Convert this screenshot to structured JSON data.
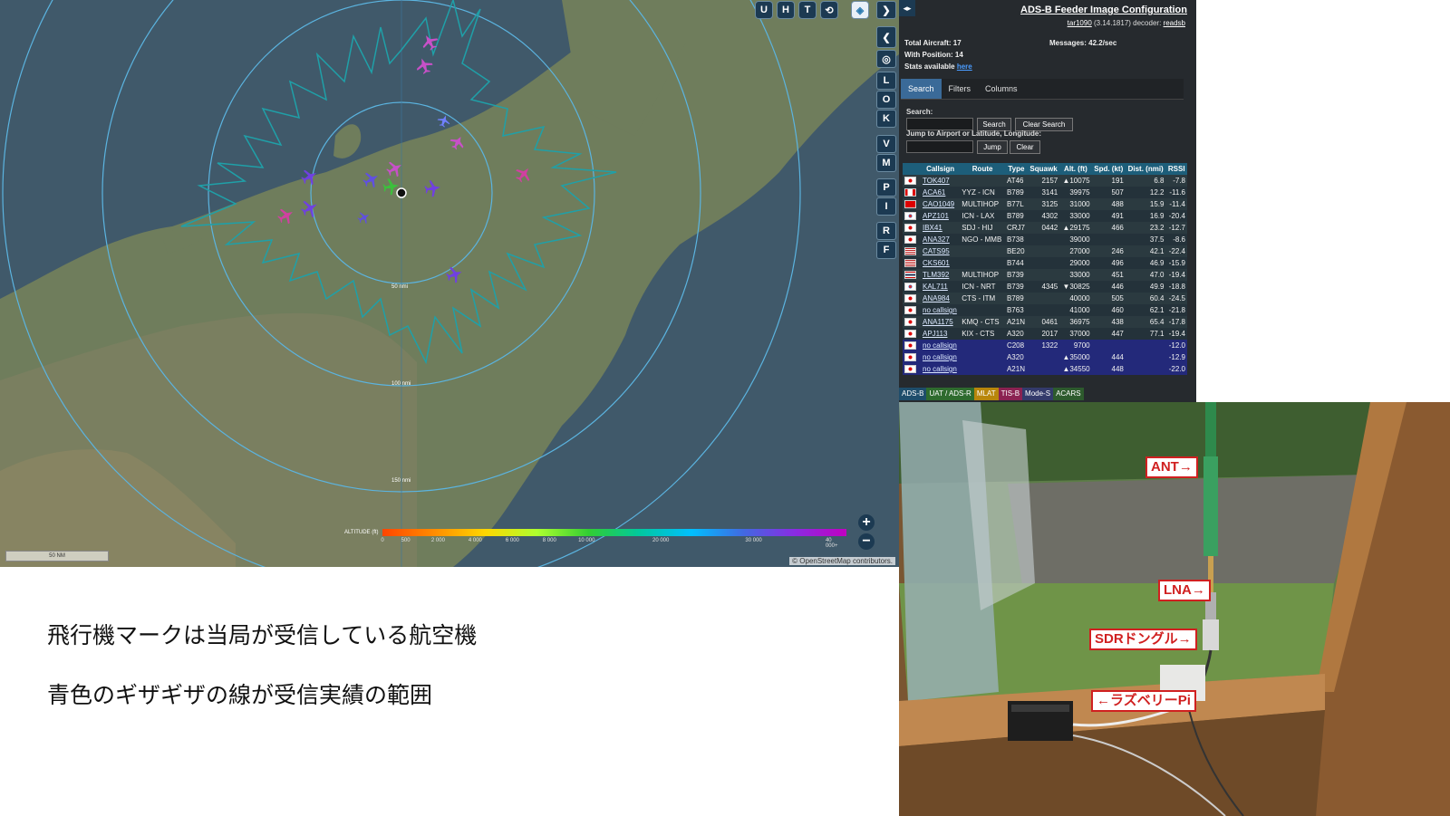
{
  "map": {
    "top_buttons": [
      "U",
      "H",
      "T"
    ],
    "side_buttons": [
      "L",
      "O",
      "K",
      "V",
      "M",
      "P",
      "I",
      "R",
      "F"
    ],
    "altitude_title": "ALTITUDE (ft)",
    "altitude_ticks": [
      "0",
      "500",
      "2 000",
      "4 000",
      "6 000",
      "8 000",
      "10 000",
      "20 000",
      "30 000",
      "40 000+"
    ],
    "ring_labels": [
      "50 nmi",
      "100 nmi",
      "150 nmi"
    ],
    "scale": "50 NM",
    "attribution": "© OpenStreetMap contributors."
  },
  "panel": {
    "title": "ADS-B Feeder Image Configuration",
    "version_link": "tar1090",
    "version_text": "(3.14.1817) decoder:",
    "decoder_link": "readsb",
    "total_aircraft": "Total Aircraft: 17",
    "with_position": "With Position: 14",
    "messages": "Messages: 42.2/sec",
    "stats_text": "Stats available",
    "stats_link": "here",
    "tabs": [
      "Search",
      "Filters",
      "Columns"
    ],
    "search_label": "Search:",
    "search_button": "Search",
    "clear_search_button": "Clear Search",
    "jump_label": "Jump to Airport or Latitude, Longitude:",
    "jump_button": "Jump",
    "clear_button": "Clear",
    "columns": [
      "Callsign",
      "Route",
      "Type",
      "Squawk",
      "Alt. (ft)",
      "Spd. (kt)",
      "Dist. (nmi)",
      "RSSI"
    ],
    "rows": [
      {
        "flag": "jp",
        "callsign": "TOK407",
        "route": "",
        "type": "AT46",
        "squawk": "2157",
        "alt": "▲10075",
        "spd": "191",
        "dist": "6.8",
        "rssi": "-7.8",
        "pos": true
      },
      {
        "flag": "ca",
        "callsign": "ACA61",
        "route": "YYZ - ICN",
        "type": "B789",
        "squawk": "3141",
        "alt": "39975",
        "spd": "507",
        "dist": "12.2",
        "rssi": "-11.6",
        "pos": true
      },
      {
        "flag": "cn",
        "callsign": "CAO1049",
        "route": "MULTIHOP",
        "type": "B77L",
        "squawk": "3125",
        "alt": "31000",
        "spd": "488",
        "dist": "15.9",
        "rssi": "-11.4",
        "pos": true
      },
      {
        "flag": "kr",
        "callsign": "APZ101",
        "route": "ICN - LAX",
        "type": "B789",
        "squawk": "4302",
        "alt": "33000",
        "spd": "491",
        "dist": "16.9",
        "rssi": "-20.4",
        "pos": true
      },
      {
        "flag": "jp",
        "callsign": "IBX41",
        "route": "SDJ - HIJ",
        "type": "CRJ7",
        "squawk": "0442",
        "alt": "▲29175",
        "spd": "466",
        "dist": "23.2",
        "rssi": "-12.7",
        "pos": true
      },
      {
        "flag": "jp",
        "callsign": "ANA327",
        "route": "NGO - MMB",
        "type": "B738",
        "squawk": "",
        "alt": "39000",
        "spd": "",
        "dist": "37.5",
        "rssi": "-8.6",
        "pos": true
      },
      {
        "flag": "us",
        "callsign": "CATS95",
        "route": "",
        "type": "BE20",
        "squawk": "",
        "alt": "27000",
        "spd": "246",
        "dist": "42.1",
        "rssi": "-22.4",
        "pos": true
      },
      {
        "flag": "us",
        "callsign": "CKS601",
        "route": "",
        "type": "B744",
        "squawk": "",
        "alt": "29000",
        "spd": "496",
        "dist": "46.9",
        "rssi": "-15.9",
        "pos": true
      },
      {
        "flag": "th",
        "callsign": "TLM392",
        "route": "MULTIHOP",
        "type": "B739",
        "squawk": "",
        "alt": "33000",
        "spd": "451",
        "dist": "47.0",
        "rssi": "-19.4",
        "pos": true
      },
      {
        "flag": "kr",
        "callsign": "KAL711",
        "route": "ICN - NRT",
        "type": "B739",
        "squawk": "4345",
        "alt": "▼30825",
        "spd": "446",
        "dist": "49.9",
        "rssi": "-18.8",
        "pos": true
      },
      {
        "flag": "jp",
        "callsign": "ANA984",
        "route": "CTS - ITM",
        "type": "B789",
        "squawk": "",
        "alt": "40000",
        "spd": "505",
        "dist": "60.4",
        "rssi": "-24.5",
        "pos": true
      },
      {
        "flag": "jp",
        "callsign": "no callsign",
        "route": "",
        "type": "B763",
        "squawk": "",
        "alt": "41000",
        "spd": "460",
        "dist": "62.1",
        "rssi": "-21.8",
        "pos": true
      },
      {
        "flag": "jp",
        "callsign": "ANA1175",
        "route": "KMQ - CTS",
        "type": "A21N",
        "squawk": "0461",
        "alt": "36975",
        "spd": "438",
        "dist": "65.4",
        "rssi": "-17.8",
        "pos": true
      },
      {
        "flag": "jp",
        "callsign": "APJ113",
        "route": "KIX - CTS",
        "type": "A320",
        "squawk": "2017",
        "alt": "37000",
        "spd": "447",
        "dist": "77.1",
        "rssi": "-19.4",
        "pos": true
      },
      {
        "flag": "jp",
        "callsign": "no callsign",
        "route": "",
        "type": "C208",
        "squawk": "1322",
        "alt": "9700",
        "spd": "",
        "dist": "",
        "rssi": "-12.0",
        "pos": false
      },
      {
        "flag": "jp",
        "callsign": "no callsign",
        "route": "",
        "type": "A320",
        "squawk": "",
        "alt": "▲35000",
        "spd": "444",
        "dist": "",
        "rssi": "-12.9",
        "pos": false
      },
      {
        "flag": "jp",
        "callsign": "no callsign",
        "route": "",
        "type": "A21N",
        "squawk": "",
        "alt": "▲34550",
        "spd": "448",
        "dist": "",
        "rssi": "-22.0",
        "pos": false
      }
    ],
    "sources": [
      {
        "label": "ADS-B",
        "bg": "#1e4d6b",
        "fg": "#ffffff"
      },
      {
        "label": "UAT / ADS-R",
        "bg": "#2e6b2e",
        "fg": "#ffffff"
      },
      {
        "label": "MLAT",
        "bg": "#b8860b",
        "fg": "#ffffff"
      },
      {
        "label": "TIS-B",
        "bg": "#8b2252",
        "fg": "#ffffff"
      },
      {
        "label": "Mode-S",
        "bg": "#333a6b",
        "fg": "#ffffff"
      },
      {
        "label": "ACARS",
        "bg": "#2d5a2d",
        "fg": "#ffffff"
      }
    ]
  },
  "photo": {
    "labels": [
      "ANT→",
      "LNA→",
      "SDRドングル→",
      "←ラズベリーPi"
    ]
  },
  "captions": [
    "飛行機マークは当局が受信している航空機",
    "青色のギザギザの線が受信実績の範囲"
  ],
  "colors": {
    "accent": "#3a6a98",
    "table_header": "#1d5e7a",
    "label_border": "#d02020"
  }
}
